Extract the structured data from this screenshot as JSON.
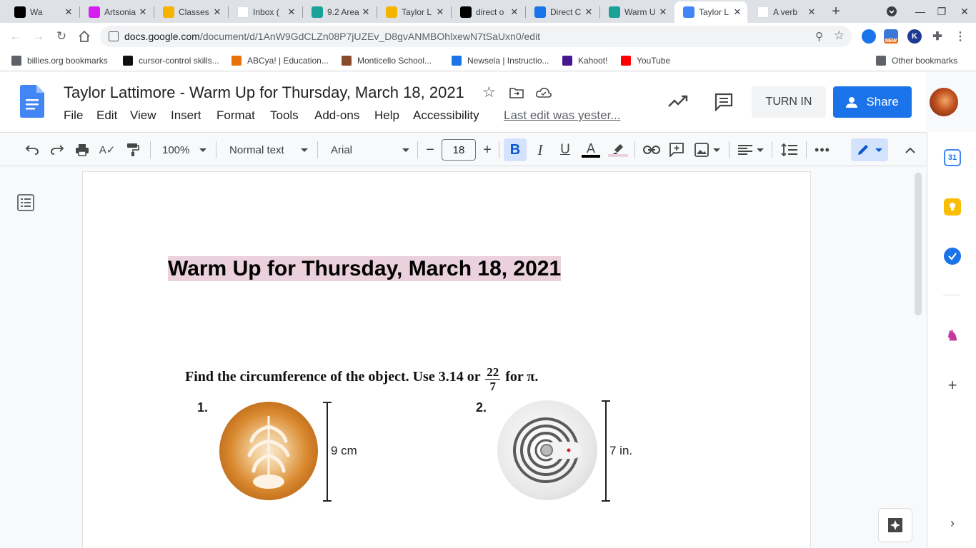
{
  "tabs": [
    {
      "title": "Wa",
      "favicon": "tiktok-icon",
      "color": "#000000"
    },
    {
      "title": "Artsonia",
      "favicon": "artsonia-icon",
      "color": "#d61ef0"
    },
    {
      "title": "Classes",
      "favicon": "classroom-icon",
      "color": "#f4b400"
    },
    {
      "title": "Inbox (",
      "favicon": "gmail-icon",
      "color": "#ffffff"
    },
    {
      "title": "9.2 Area",
      "favicon": "assignment-icon",
      "color": "#1aa198"
    },
    {
      "title": "Taylor L",
      "favicon": "slides-icon",
      "color": "#f4b400"
    },
    {
      "title": "direct o",
      "favicon": "brainly-icon",
      "color": "#000000"
    },
    {
      "title": "Direct C",
      "favicon": "classroom-person-icon",
      "color": "#1a73e8"
    },
    {
      "title": "Warm U",
      "favicon": "assignment-icon",
      "color": "#1aa198"
    },
    {
      "title": "Taylor L",
      "favicon": "docs-icon",
      "color": "#4285f4",
      "active": true
    },
    {
      "title": "A verb",
      "favicon": "google-icon",
      "color": "#ffffff"
    }
  ],
  "omnibox": {
    "host": "docs.google.com",
    "path": "/document/d/1AnW9GdCLZn08P7jUZEv_D8gvANMBOhlxewN7tSaUxn0/edit"
  },
  "extensions": {
    "new_badge": "NEW",
    "k_letter": "K"
  },
  "bookmarks": [
    {
      "label": "billies.org bookmarks",
      "icon": "folder-icon"
    },
    {
      "label": "cursor-control skills...",
      "icon": "m-icon"
    },
    {
      "label": "ABCya! | Education...",
      "icon": "abcya-icon"
    },
    {
      "label": "Monticello School...",
      "icon": "monticello-icon"
    },
    {
      "label": "Newsela | Instructio...",
      "icon": "newsela-icon"
    },
    {
      "label": "Kahoot!",
      "icon": "kahoot-icon"
    },
    {
      "label": "YouTube",
      "icon": "youtube-icon"
    }
  ],
  "other_bookmarks": "Other bookmarks",
  "doc": {
    "title": "Taylor Lattimore - Warm Up for Thursday, March 18, 2021",
    "menus": [
      "File",
      "Edit",
      "View",
      "Insert",
      "Format",
      "Tools",
      "Add-ons",
      "Help",
      "Accessibility"
    ],
    "last_edit": "Last edit was yester...",
    "turn_in": "TURN IN",
    "share": "Share"
  },
  "format_toolbar": {
    "zoom": "100%",
    "style": "Normal text",
    "font": "Arial",
    "font_size": "18"
  },
  "content": {
    "heading": "Warm Up for Thursday, March 18, 2021",
    "problem_prefix": "Find the circumference of the object. Use 3.14 or",
    "fraction_num": "22",
    "fraction_den": "7",
    "problem_suffix": "for π.",
    "item1_num": "1.",
    "item1_label": "9 cm",
    "item2_num": "2.",
    "item2_label": "7 in."
  },
  "side_panel": {
    "calendar_day": "31"
  },
  "colors": {
    "accent": "#1a73e8",
    "heading_highlight": "#ead1dc",
    "docs_blue": "#4285f4"
  }
}
